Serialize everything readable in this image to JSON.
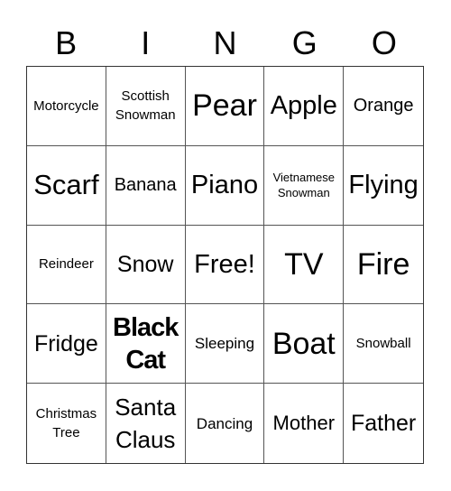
{
  "card": {
    "header": [
      "B",
      "I",
      "N",
      "G",
      "O"
    ],
    "cells": [
      {
        "text": "Motorcycle"
      },
      {
        "text": "Scottish Snowman"
      },
      {
        "text": "Pear"
      },
      {
        "text": "Apple"
      },
      {
        "text": "Orange"
      },
      {
        "text": "Scarf"
      },
      {
        "text": "Banana"
      },
      {
        "text": "Piano"
      },
      {
        "text": "Vietnamese Snowman"
      },
      {
        "text": "Flying"
      },
      {
        "text": "Reindeer"
      },
      {
        "text": "Snow"
      },
      {
        "text": "Free!"
      },
      {
        "text": "TV"
      },
      {
        "text": "Fire"
      },
      {
        "text": "Fridge"
      },
      {
        "text": "Black Cat"
      },
      {
        "text": "Sleeping"
      },
      {
        "text": "Boat"
      },
      {
        "text": "Snowball"
      },
      {
        "text": "Christmas Tree"
      },
      {
        "text": "Santa Claus"
      },
      {
        "text": "Dancing"
      },
      {
        "text": "Mother"
      },
      {
        "text": "Father"
      }
    ]
  }
}
